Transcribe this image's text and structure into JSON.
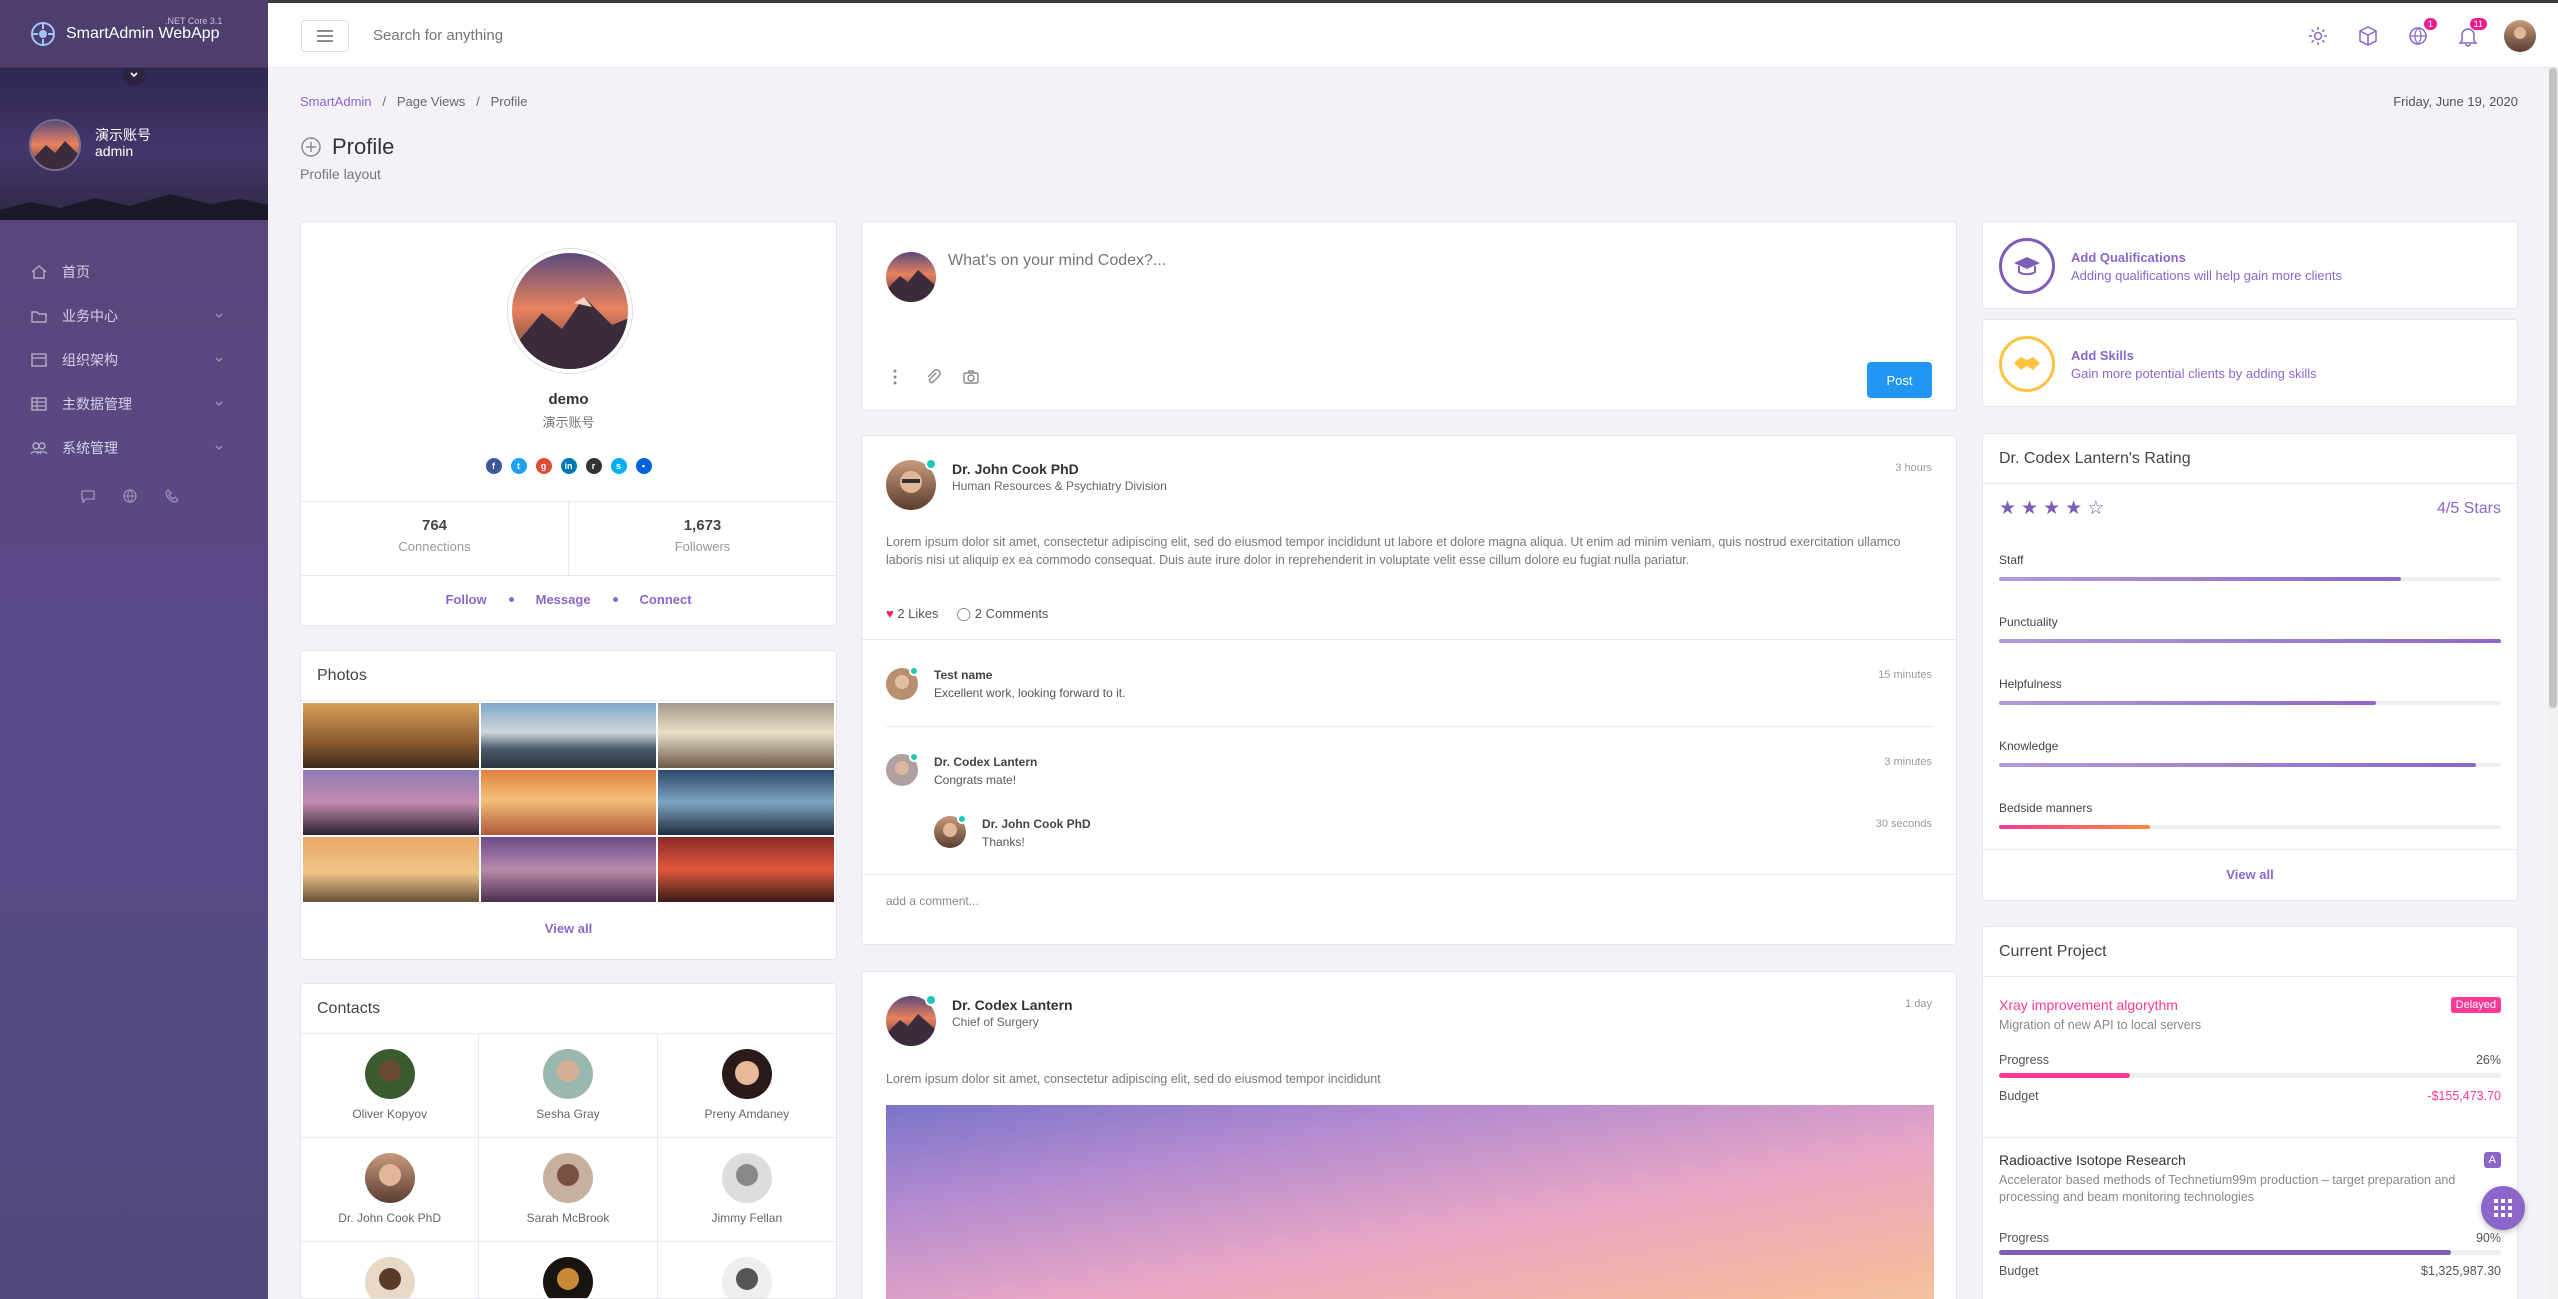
{
  "brand": {
    "name": "SmartAdmin WebApp",
    "version": ".NET Core 3.1"
  },
  "user": {
    "name": "演示账号",
    "role": "admin"
  },
  "sidebar": {
    "items": [
      {
        "label": "首页",
        "icon": "home-icon"
      },
      {
        "label": "业务中心",
        "icon": "folder-icon"
      },
      {
        "label": "组织架构",
        "icon": "calendar-icon"
      },
      {
        "label": "主数据管理",
        "icon": "table-icon"
      },
      {
        "label": "系统管理",
        "icon": "people-icon"
      }
    ]
  },
  "topbar": {
    "search_placeholder": "Search for anything",
    "badges": {
      "globe": "1",
      "bell": "11"
    }
  },
  "breadcrumb": [
    "SmartAdmin",
    "Page Views",
    "Profile"
  ],
  "date": "Friday, June 19, 2020",
  "page": {
    "title": "Profile",
    "subtitle": "Profile layout"
  },
  "profile": {
    "name": "demo",
    "alt_name": "演示账号",
    "connections": "764",
    "connections_label": "Connections",
    "followers": "1,673",
    "followers_label": "Followers",
    "actions": [
      "Follow",
      "Message",
      "Connect"
    ]
  },
  "photos": {
    "title": "Photos",
    "view_all": "View all"
  },
  "contacts": {
    "title": "Contacts",
    "items": [
      "Oliver Kopyov",
      "Sesha Gray",
      "Preny Amdaney",
      "Dr. John Cook PhD",
      "Sarah McBrook",
      "Jimmy Fellan"
    ]
  },
  "composer": {
    "placeholder": "What's on your mind Codex?...",
    "post_label": "Post"
  },
  "post1": {
    "author": "Dr. John Cook PhD",
    "role": "Human Resources & Psychiatry Division",
    "time": "3 hours",
    "text": "Lorem ipsum dolor sit amet, consectetur adipiscing elit, sed do eiusmod tempor incididunt ut labore et dolore magna aliqua. Ut enim ad minim veniam, quis nostrud exercitation ullamco laboris nisi ut aliquip ex ea commodo consequat. Duis aute irure dolor in reprehenderit in voluptate velit esse cillum dolore eu fugiat nulla pariatur.",
    "likes": "2 Likes",
    "comments": "2 Comments",
    "comment_list": [
      {
        "name": "Test name",
        "text": "Excellent work, looking forward to it.",
        "time": "15 minutes"
      },
      {
        "name": "Dr. Codex Lantern",
        "text": "Congrats mate!",
        "time": "3 minutes"
      },
      {
        "name": "Dr. John Cook PhD",
        "text": "Thanks!",
        "time": "30 seconds"
      }
    ],
    "add_comment": "add a comment..."
  },
  "post2": {
    "author": "Dr. Codex Lantern",
    "role": "Chief of Surgery",
    "time": "1 day",
    "text": "Lorem ipsum dolor sit amet, consectetur adipiscing elit, sed do eiusmod tempor incididunt"
  },
  "qualifications": {
    "title": "Add Qualifications",
    "subtitle": "Adding qualifications will help gain more clients"
  },
  "skills": {
    "title": "Add Skills",
    "subtitle": "Gain more potential clients by adding skills"
  },
  "rating": {
    "title": "Dr. Codex Lantern's Rating",
    "stars": 4,
    "max_stars": 5,
    "label": "4/5 Stars",
    "bars": [
      {
        "label": "Staff",
        "value": 0.8
      },
      {
        "label": "Punctuality",
        "value": 1.0
      },
      {
        "label": "Helpfulness",
        "value": 0.75
      },
      {
        "label": "Knowledge",
        "value": 0.95
      },
      {
        "label": "Bedside manners",
        "value": 0.3
      }
    ],
    "view_all": "View all"
  },
  "project": {
    "title": "Current Project",
    "items": [
      {
        "name": "Xray improvement algorythm",
        "desc": "Migration of new API to local servers",
        "badge": "Delayed",
        "progress_label": "Progress",
        "progress": "26%",
        "budget_label": "Budget",
        "budget": "-$155,473.70"
      },
      {
        "name": "Radioactive Isotope Research",
        "desc": "Accelerator based methods of Technetium99m production – target preparation and processing and beam monitoring technologies",
        "badge": "A",
        "progress_label": "Progress",
        "progress": "90%",
        "budget_label": "Budget",
        "budget": "$1,325,987.30"
      }
    ]
  },
  "colors": {
    "accent": "#8b67c9",
    "primary": "#2196f3",
    "danger": "#fd3995",
    "success": "#1dc9b7"
  }
}
